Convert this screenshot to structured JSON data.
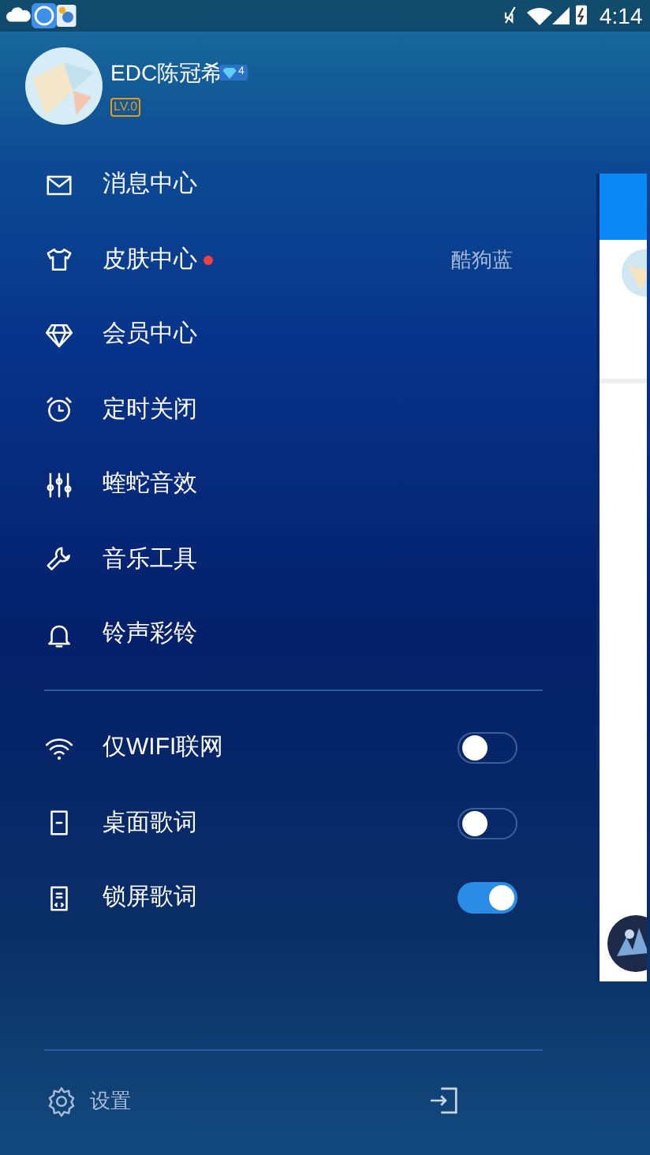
{
  "status_bar": {
    "time": "4:14"
  },
  "profile": {
    "name": "EDC陈冠希",
    "vip_badge": "4",
    "level": "LV.0"
  },
  "menu": [
    {
      "kind": "mail",
      "label": "消息中心"
    },
    {
      "kind": "shirt",
      "label": "皮肤中心",
      "new_dot": true,
      "value": "酷狗蓝"
    },
    {
      "kind": "diamond",
      "label": "会员中心"
    },
    {
      "kind": "alarm",
      "label": "定时关闭"
    },
    {
      "kind": "sliders",
      "label": "蝰蛇音效"
    },
    {
      "kind": "wrench",
      "label": "音乐工具"
    },
    {
      "kind": "bell",
      "label": "铃声彩铃"
    }
  ],
  "toggles": [
    {
      "kind": "wifi",
      "label": "仅WIFI联网",
      "on": false
    },
    {
      "kind": "phone",
      "label": "桌面歌词",
      "on": false
    },
    {
      "kind": "lockphone",
      "label": "锁屏歌词",
      "on": true
    }
  ],
  "footer": {
    "settings": "设置"
  }
}
